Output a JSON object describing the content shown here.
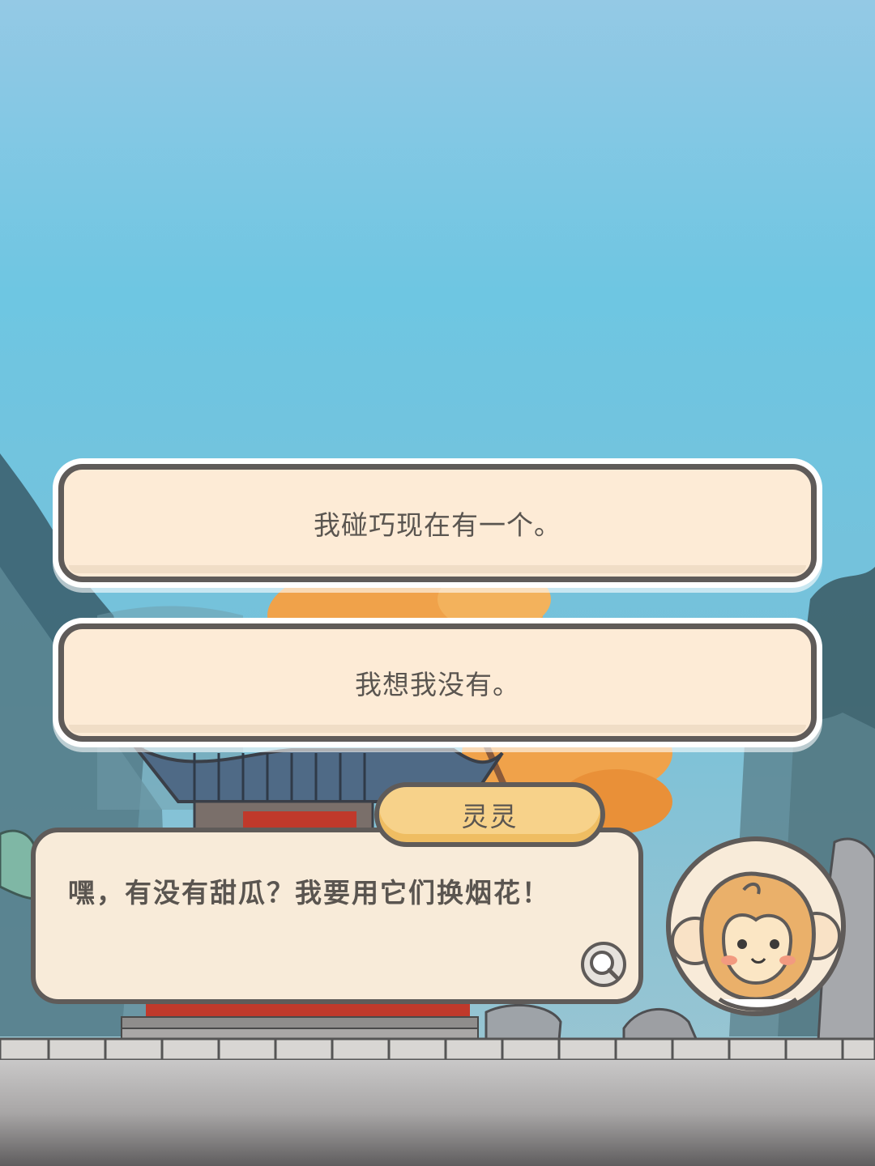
{
  "dialogue": {
    "choices": [
      {
        "label": "我碰巧现在有一个。"
      },
      {
        "label": "我想我没有。"
      }
    ],
    "speaker_name": "灵灵",
    "speech_text": "嘿，有没有甜瓜？我要用它们换烟花！",
    "magnify_icon": "magnifier-icon",
    "portrait_icon": "monkey-portrait-icon"
  },
  "colors": {
    "sky_top": "#8fc8e6",
    "sky_mid": "#6cc3e0",
    "choice_fill": "#fdebd6",
    "outline": "#5f5b59",
    "name_tag_fill": "#f7d28a",
    "bubble_fill": "#f8ebd9",
    "autumn_tree": "#f0a24a"
  }
}
